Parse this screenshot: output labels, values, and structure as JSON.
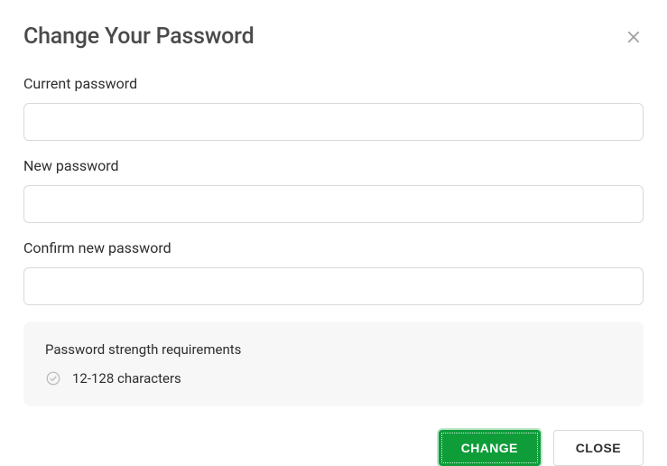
{
  "modal": {
    "title": "Change Your Password"
  },
  "fields": {
    "current": {
      "label": "Current password",
      "value": ""
    },
    "new": {
      "label": "New password",
      "value": ""
    },
    "confirm": {
      "label": "Confirm new password",
      "value": ""
    }
  },
  "requirements": {
    "title": "Password strength requirements",
    "items": [
      "12-128 characters"
    ]
  },
  "buttons": {
    "change": "CHANGE",
    "close": "CLOSE"
  }
}
